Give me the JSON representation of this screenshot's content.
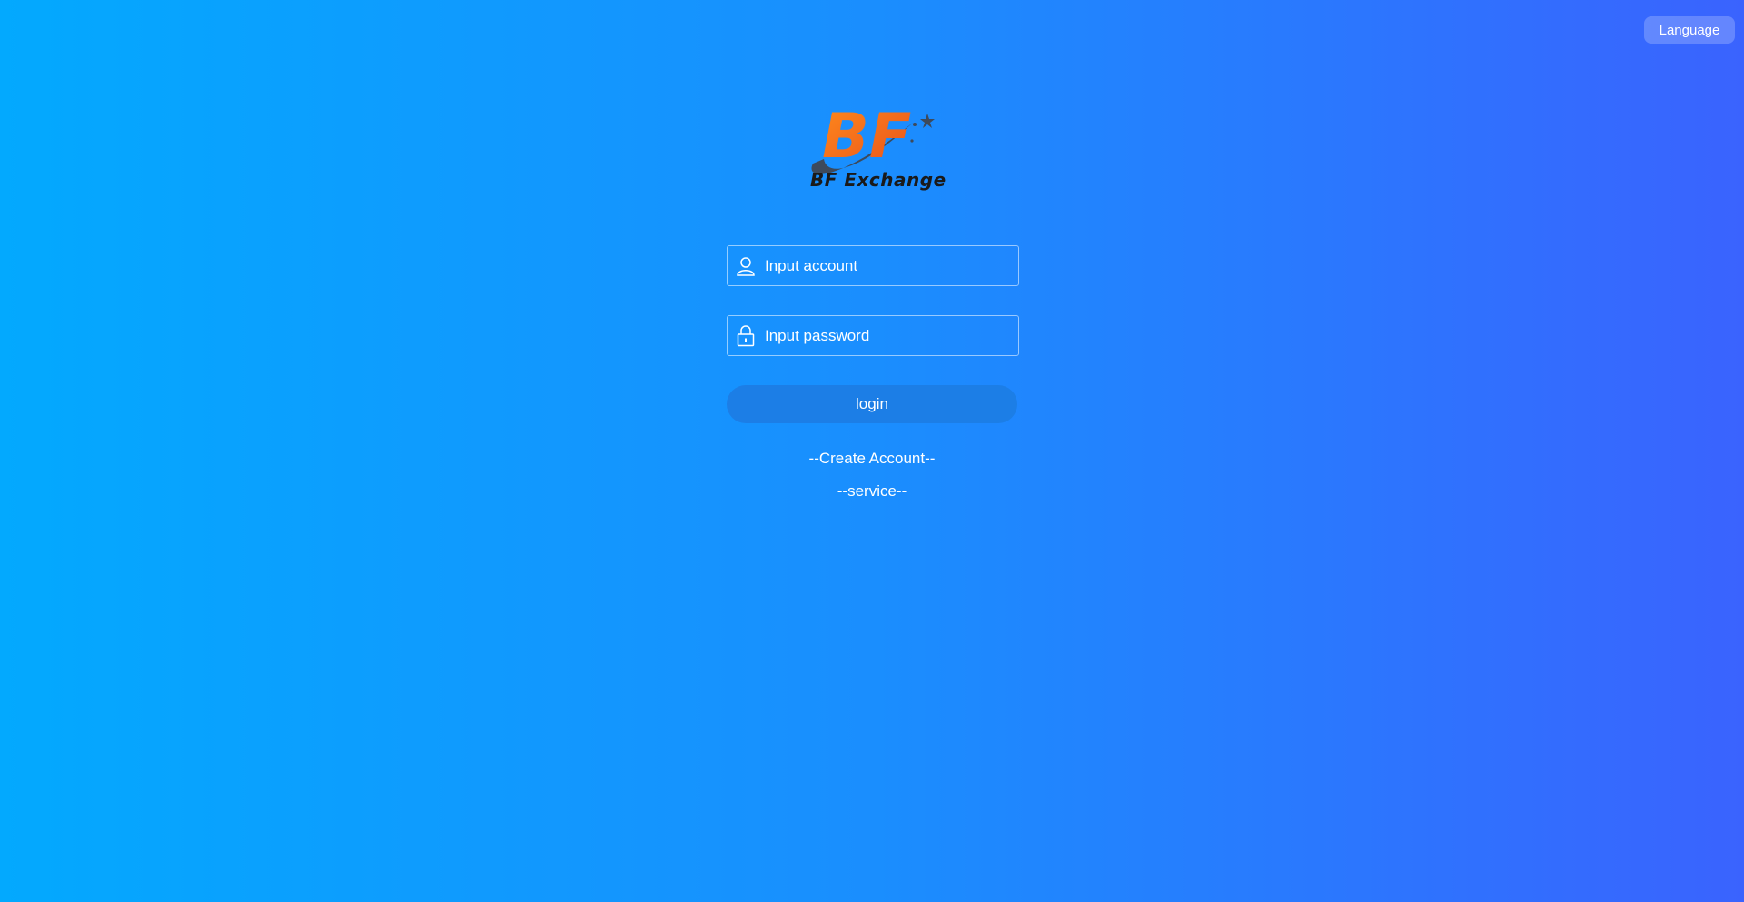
{
  "header": {
    "language_label": "Language"
  },
  "brand": {
    "logo_letters": "BF",
    "name": "BF Exchange",
    "colors": {
      "orange": "#f26a21",
      "orange_light": "#ff9a1f",
      "swoosh": "#3d4a5c"
    }
  },
  "form": {
    "account": {
      "placeholder": "Input account",
      "value": "",
      "icon": "user-icon"
    },
    "password": {
      "placeholder": "Input password",
      "value": "",
      "icon": "lock-icon"
    },
    "login_label": "login"
  },
  "links": {
    "create_account": "--Create Account--",
    "service": "--service--"
  },
  "colors": {
    "gradient_start": "#03a9fe",
    "gradient_end": "#3a63fe",
    "button": "#1c7ee6"
  }
}
